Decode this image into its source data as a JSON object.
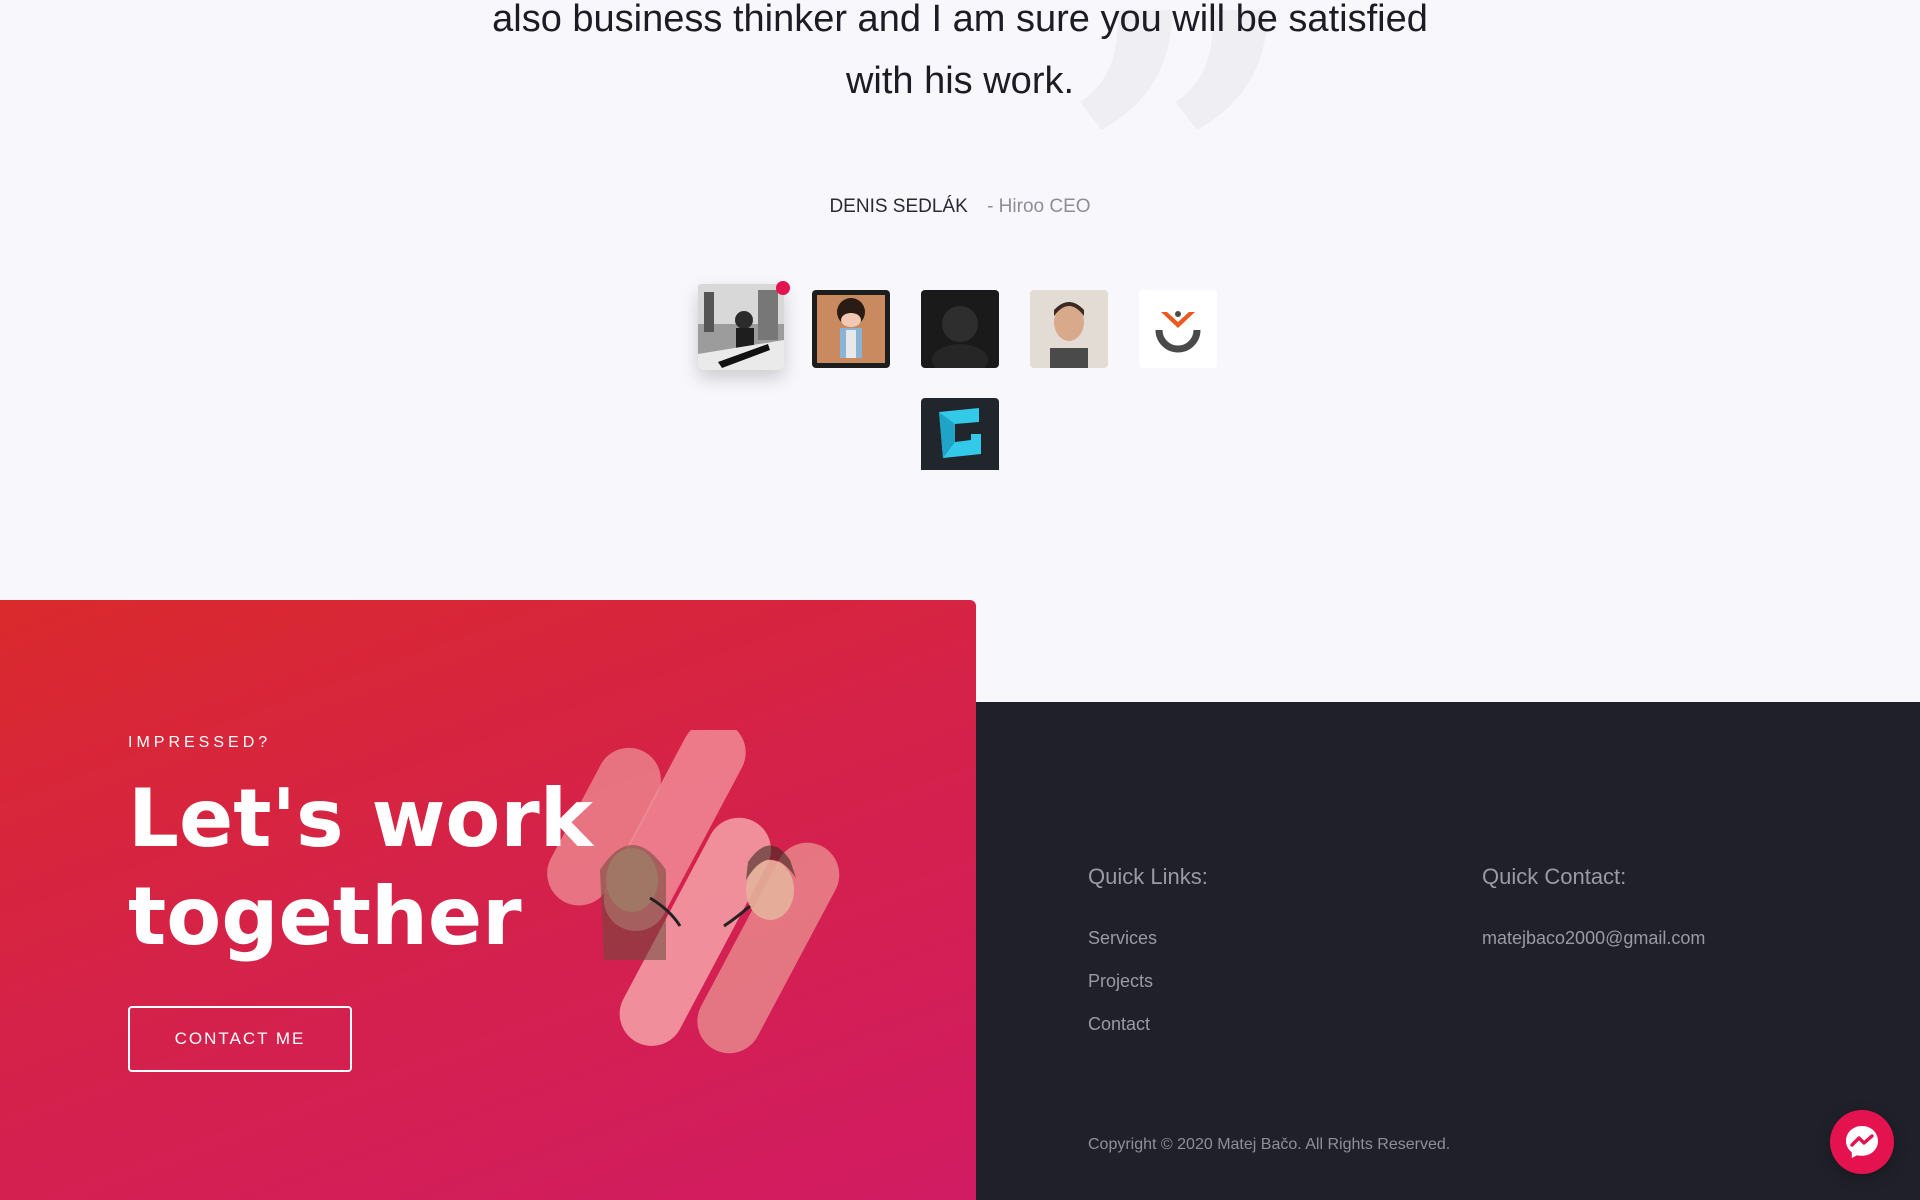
{
  "testimonial": {
    "quote_line1": "also business thinker and I am sure you will be satisfied",
    "quote_line2": "with his work.",
    "author_name": "DENIS SEDLÁK",
    "author_role": "- Hiroo CEO",
    "thumbnails": [
      {
        "name": "client-avatar-1",
        "active": true
      },
      {
        "name": "client-avatar-2",
        "active": false
      },
      {
        "name": "client-avatar-3",
        "active": false
      },
      {
        "name": "client-avatar-4",
        "active": false
      },
      {
        "name": "client-logo-5",
        "active": false
      },
      {
        "name": "client-logo-6",
        "active": false
      }
    ]
  },
  "cta": {
    "eyebrow": "IMPRESSED?",
    "headline_line1": "Let's work",
    "headline_line2": "together",
    "button_label": "CONTACT ME"
  },
  "footer": {
    "quick_links_title": "Quick Links:",
    "links": [
      "Services",
      "Projects",
      "Contact"
    ],
    "quick_contact_title": "Quick Contact:",
    "email": "matejbaco2000@gmail.com",
    "copyright": "Copyright © 2020 Matej Bačo. All Rights Reserved."
  },
  "colors": {
    "accent": "#e4134f",
    "cta_gradient_start": "#da2a2c",
    "cta_gradient_end": "#d11b63",
    "footer_bg": "#1f2029"
  },
  "icons": {
    "messenger": "messenger-icon",
    "quote": "quote-mark-icon"
  }
}
